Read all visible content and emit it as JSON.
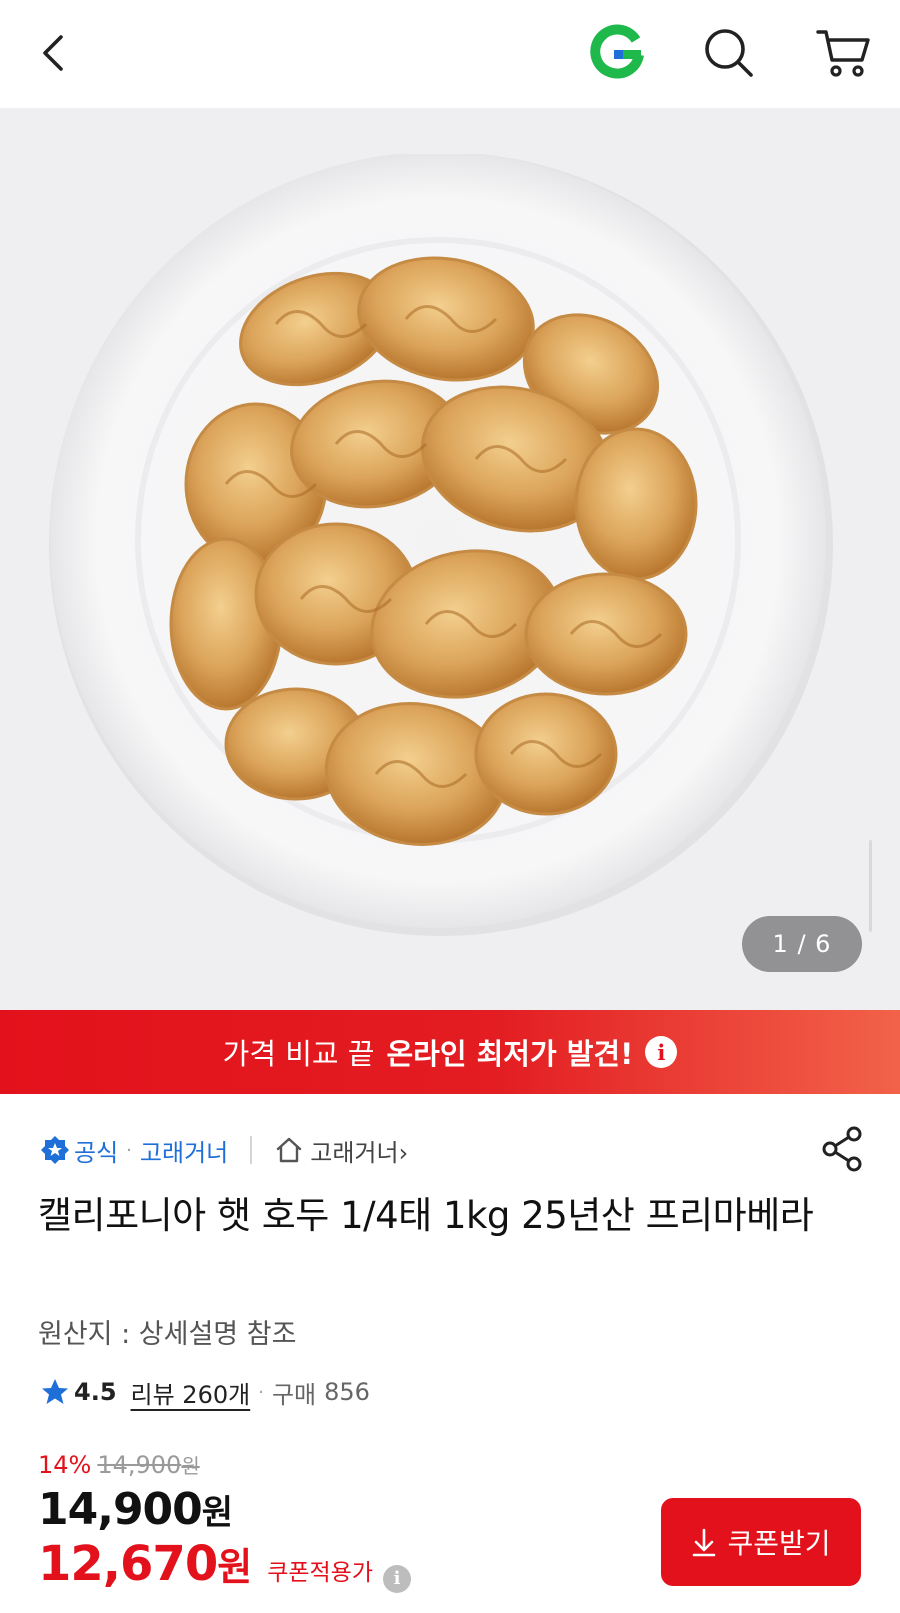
{
  "header": {
    "back_icon": "chevron-left-icon",
    "logo_letter": "G",
    "logo_colors": {
      "green": "#1fb84a",
      "blue": "#1f6fd9"
    },
    "search_icon": "search-icon",
    "cart_icon": "cart-icon"
  },
  "gallery": {
    "counter": "1 / 6",
    "current": 1,
    "total": 6
  },
  "promo": {
    "text_regular": "가격 비교 끝",
    "text_bold": "온라인 최저가 발견!",
    "info_glyph": "i",
    "color": "#e3111b"
  },
  "product": {
    "official_label": "공식",
    "seller_name": "고래거너",
    "store_link": "고래거너",
    "store_chevron": "›",
    "title": "캘리포니아 햇 호두 1/4태 1kg 25년산 프리마베라",
    "origin": "원산지 : 상세설명 참조",
    "rating": "4.5",
    "review_text": "리뷰 260개",
    "purchase_label": "구매",
    "purchase_count": "856",
    "discount_percent": "14%",
    "original_price": "14,900",
    "original_unit": "원",
    "price": "14,900",
    "price_unit": "원",
    "coupon_price": "12,670",
    "coupon_price_unit": "원",
    "coupon_applied_label": "쿠폰적용가",
    "coupon_info_glyph": "i",
    "coupon_button_label": "쿠폰받기",
    "accent_color": "#e3111b",
    "link_color": "#1f6fd9"
  }
}
